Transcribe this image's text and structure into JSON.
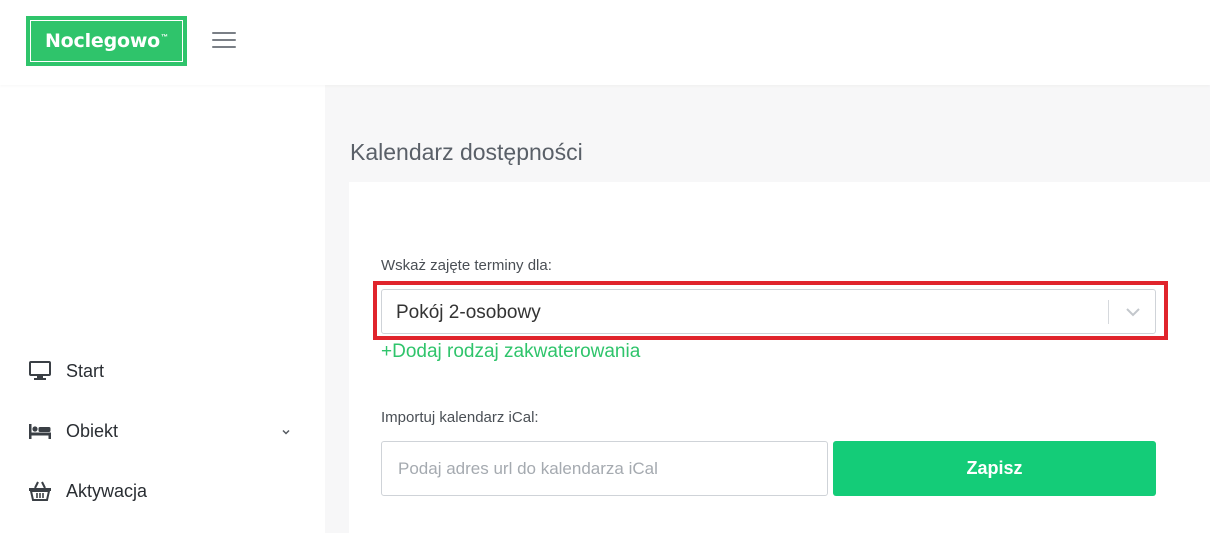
{
  "brand": {
    "logo_text": "Noclegowo",
    "logo_tm": "™",
    "accent_color": "#2fc46b",
    "button_color": "#14cc78",
    "highlight_color": "#e0242c"
  },
  "header": {
    "menu_icon": "hamburger-icon"
  },
  "sidebar": {
    "items": [
      {
        "label": "Start",
        "icon": "monitor-icon"
      },
      {
        "label": "Obiekt",
        "icon": "bed-icon",
        "has_chevron": true
      },
      {
        "label": "Aktywacja",
        "icon": "basket-icon"
      }
    ]
  },
  "main": {
    "title": "Kalendarz dostępności",
    "occupied_label": "Wskaż zajęte terminy dla:",
    "room_select": {
      "selected_value": "Pokój 2-osobowy"
    },
    "add_accommodation_link": "+Dodaj rodzaj zakwaterowania",
    "ical_label": "Importuj kalendarz iCal:",
    "ical_input": {
      "value": "",
      "placeholder": "Podaj adres url do kalendarza iCal"
    },
    "save_button": "Zapisz"
  }
}
